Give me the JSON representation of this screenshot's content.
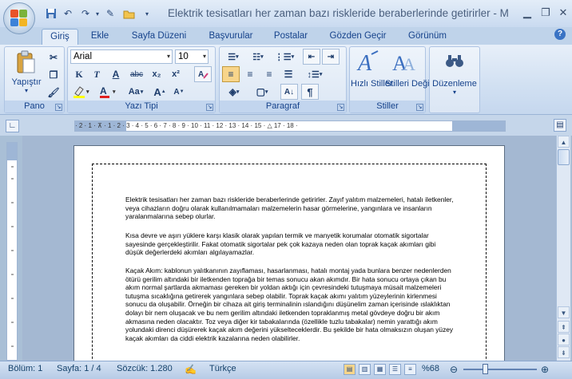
{
  "window": {
    "title": "Elektrik tesisatları her zaman bazı riskleride beraberlerinde getirirler - M",
    "quick_access": [
      "save-icon",
      "undo-icon",
      "redo-icon",
      "format-painter-icon",
      "open-folder-icon"
    ]
  },
  "tabs": [
    {
      "label": "Giriş",
      "active": true
    },
    {
      "label": "Ekle"
    },
    {
      "label": "Sayfa Düzeni"
    },
    {
      "label": "Başvurular"
    },
    {
      "label": "Postalar"
    },
    {
      "label": "Gözden Geçir"
    },
    {
      "label": "Görünüm"
    }
  ],
  "ribbon": {
    "pano": {
      "label": "Pano",
      "paste_label": "Yapıştır"
    },
    "font": {
      "label": "Yazı Tipi",
      "family": "Arial",
      "size": "10",
      "bold": "K",
      "italic": "T",
      "underline": "A",
      "strike": "abc",
      "subscript": "x₂",
      "superscript": "x²",
      "case": "Aa",
      "grow": "A",
      "shrink": "A"
    },
    "paragraph": {
      "label": "Paragraf"
    },
    "styles": {
      "label": "Stiller",
      "quick_styles_label": "Hızlı Stiller",
      "change_styles_label": "Stilleri Değiştir"
    },
    "editing": {
      "label": "Düzenleme"
    }
  },
  "ruler": {
    "horizontal_ticks": "· 2 · 1 · ⊼ · 1 · 2 · 3 · 4 · 5 · 6 · 7 · 8 · 9 · 10 · 11 · 12 · 13 · 14 · 15 · △ 17 · 18 ·"
  },
  "document": {
    "paragraphs": [
      "Elektrik tesisatları her zaman bazı riskleride beraberlerinde getirirler. Zayıf yalıtım malzemeleri, hatalı iletkenler, veya cihazların doğru olarak kullanılmamaları malzemelerin hasar görmelerine, yangınlara ve insanların yaralanmalarına sebep olurlar.",
      "Kısa devre ve aşırı yüklere karşı klasik olarak yapılan termik ve manyetik korumalar otomatik sigortalar sayesinde gerçekleştirilir. Fakat otomatik sigortalar pek çok kazaya neden olan toprak kaçak akımları gibi düşük değerlerdeki akımları algılayamazlar.",
      "Kaçak Akım: kablonun yalıtkanının zayıflaması, hasarlanması, hatalı montaj yada bunlara benzer nedenlerden ötürü gerilim altındaki bir iletkenden toprağa bir temas sonucu akan akımdır. Bir hata sonucu ortaya çıkan bu akım normal şartlarda akmaması gereken bir yoldan aktığı için çevresindeki tutuşmaya müsait malzemeleri tutuşma sıcaklığına getirerek yangınlara sebep olabilir. Toprak kaçak akımı yalıtım yüzeylerinin kirlenmesi sonucu da oluşabilir. Örneğin bir cihaza ait giriş terminalinin ıslandığını düşünelim zaman içerisinde ıslaklıktan dolayı bir nem oluşacak ve bu nem gerilim altındaki iletkenden topraklanmış metal gövdeye doğru bir akım akmasına neden olacaktır. Toz veya diğer kir tabakalarında (özellikle tuzlu tabakalar) nemin yarattığı akım yolundaki direnci düşürerek kaçak akım değerini yükselteceklerdir. Bu şekilde bir hata olmaksızın oluşan yüzey kaçak akımları da ciddi elektrik kazalarına neden olabilirler."
    ]
  },
  "status": {
    "section": "Bölüm: 1",
    "page": "Sayfa: 1 / 4",
    "words": "Sözcük: 1.280",
    "language": "Türkçe",
    "zoom": "%68"
  },
  "colors": {
    "accent": "#15428b",
    "ribbon_bg": "#d1e0f2",
    "doc_bg": "#a4b8d2"
  }
}
